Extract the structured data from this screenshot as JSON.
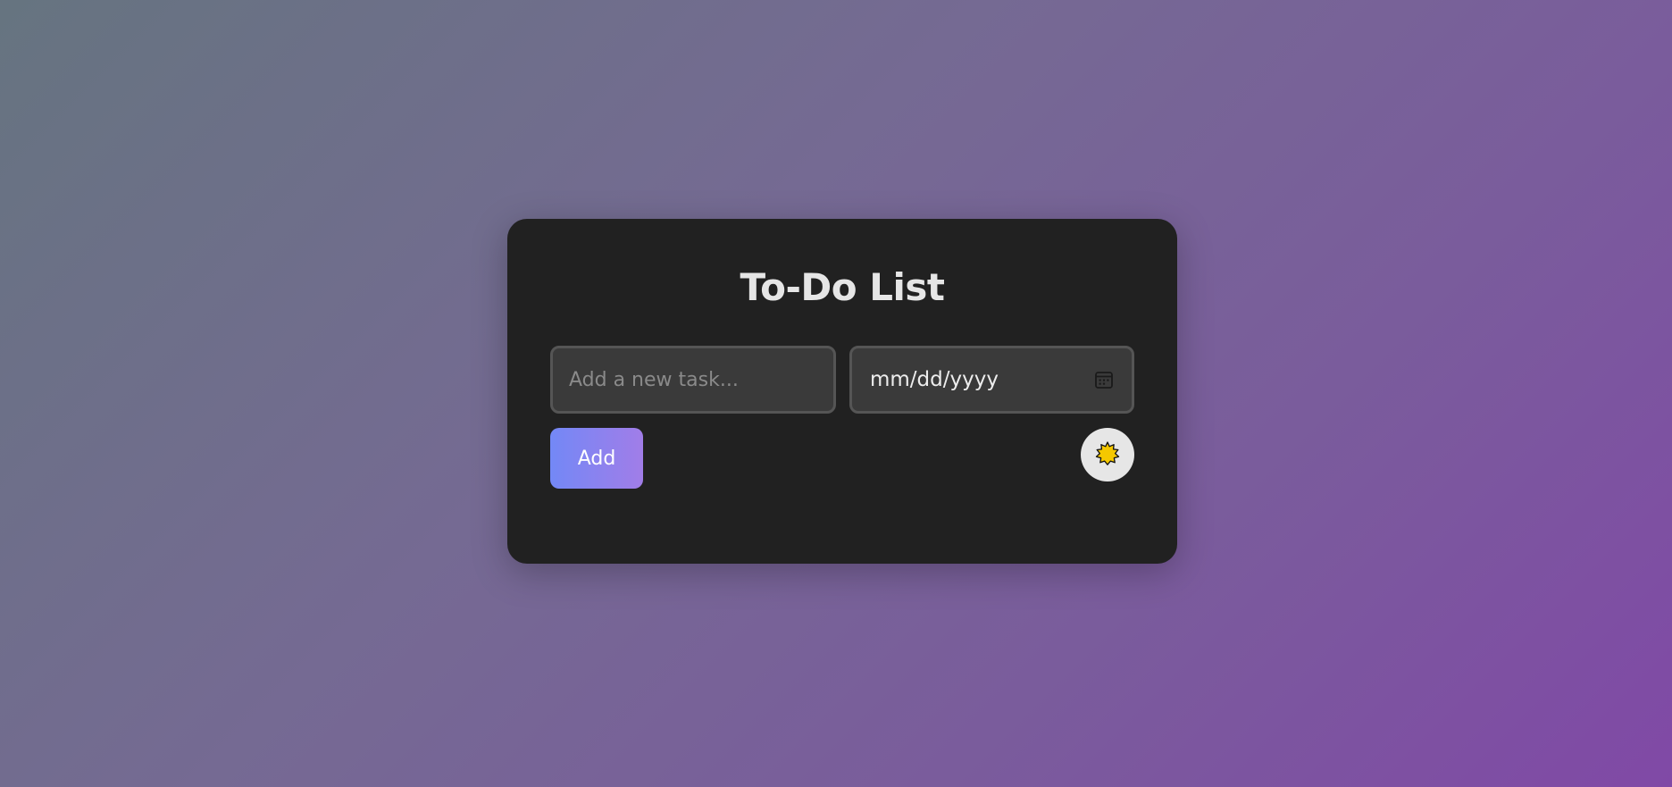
{
  "app": {
    "title": "To-Do List"
  },
  "task_input": {
    "value": "",
    "placeholder": "Add a new task..."
  },
  "date_input": {
    "placeholder": "mm/dd/yyyy",
    "icon": "calendar-icon"
  },
  "add_button": {
    "label": "Add"
  },
  "theme_toggle": {
    "icon": "sun-icon"
  },
  "colors": {
    "card_background": "#212121",
    "button_gradient_start": "#7388f6",
    "button_gradient_end": "#a17de8",
    "sun_fill": "#f5c800"
  }
}
